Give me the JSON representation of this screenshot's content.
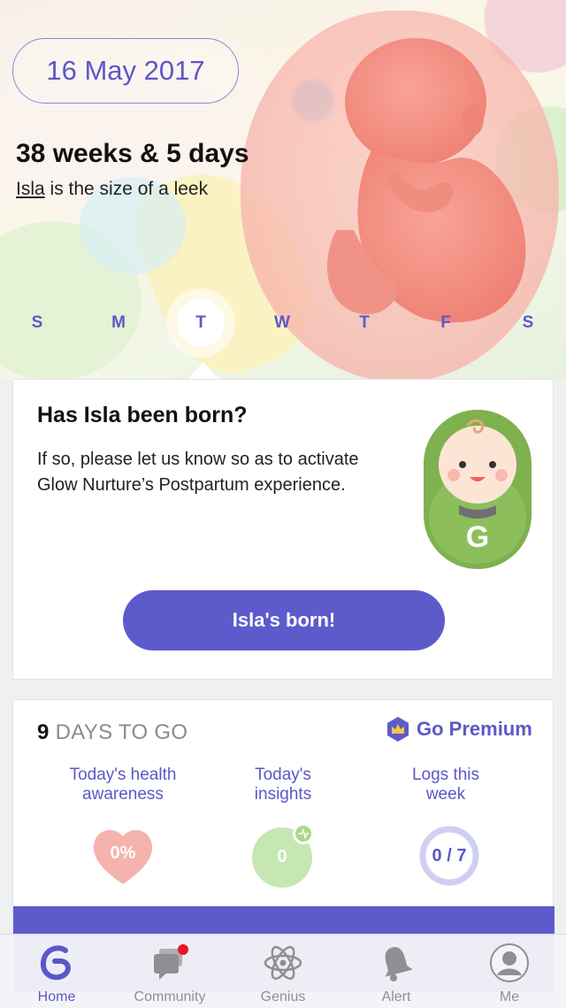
{
  "header": {
    "date": "16 May 2017",
    "weeks_text": "38 weeks & 5 days",
    "baby_name": "Isla",
    "size_text": " is the size of a leek"
  },
  "week_days": [
    {
      "label": "S",
      "active": false
    },
    {
      "label": "M",
      "active": false
    },
    {
      "label": "T",
      "active": true
    },
    {
      "label": "W",
      "active": false
    },
    {
      "label": "T",
      "active": false
    },
    {
      "label": "F",
      "active": false
    },
    {
      "label": "S",
      "active": false
    }
  ],
  "born_card": {
    "title": "Has Isla been born?",
    "body": "If so, please let us know so as to activate Glow Nurture’s Postpartum experience.",
    "button_label": "Isla's born!"
  },
  "progress_card": {
    "days_number": "9",
    "days_text": " DAYS TO GO",
    "premium_label": "Go Premium",
    "stats": [
      {
        "label_line1": "Today's health",
        "label_line2": "awareness",
        "value": "0%",
        "percent": 0
      },
      {
        "label_line1": "Today's",
        "label_line2": "insights",
        "value": "0",
        "count": 0
      },
      {
        "label_line1": "Logs this",
        "label_line2": "week",
        "value": "0 / 7",
        "logged": 0,
        "total": 7
      }
    ]
  },
  "tabbar": {
    "tabs": [
      {
        "label": "Home",
        "icon": "glow-logo-icon",
        "active": true
      },
      {
        "label": "Community",
        "icon": "chat-bubbles-icon",
        "active": false,
        "badge": true
      },
      {
        "label": "Genius",
        "icon": "atom-icon",
        "active": false
      },
      {
        "label": "Alert",
        "icon": "bell-icon",
        "active": false
      },
      {
        "label": "Me",
        "icon": "profile-icon",
        "active": false
      }
    ]
  },
  "colors": {
    "accent": "#5d5bcc",
    "accent_text": "#5b58c7",
    "health_pink": "#f4b3ad",
    "insight_green": "#c6e7b2",
    "logs_ring": "#cfd0f1",
    "notification_red": "#f0141e"
  }
}
